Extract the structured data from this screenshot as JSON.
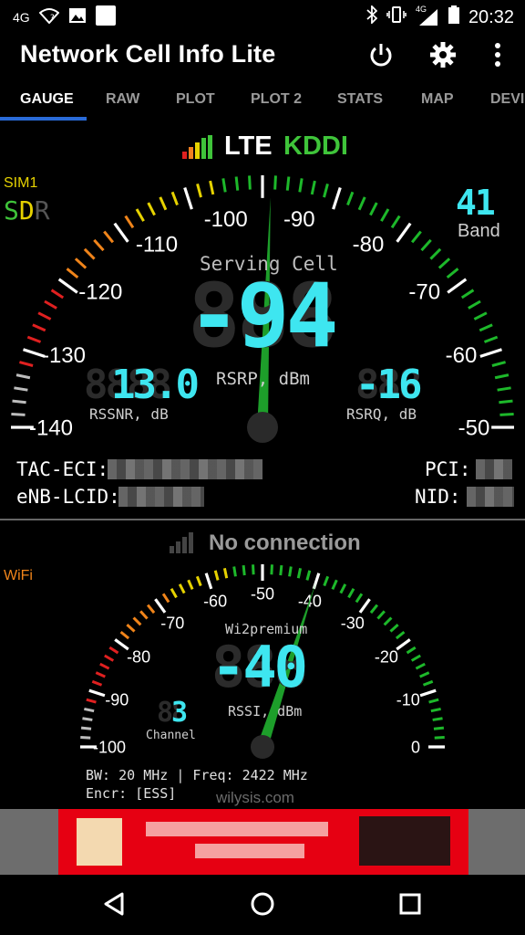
{
  "status": {
    "network_left": "4G",
    "network_right": "4G",
    "time": "20:32"
  },
  "app": {
    "title": "Network Cell Info Lite"
  },
  "tabs": [
    {
      "label": "GAUGE"
    },
    {
      "label": "RAW"
    },
    {
      "label": "PLOT"
    },
    {
      "label": "PLOT 2"
    },
    {
      "label": "STATS"
    },
    {
      "label": "MAP"
    },
    {
      "label": "DEVI"
    }
  ],
  "cell": {
    "tech": "LTE",
    "operator": "KDDI",
    "sim_label": "SIM1",
    "sdr_s": "S",
    "sdr_d": "D",
    "sdr_r": "R",
    "band_value": "41",
    "band_label": "Band",
    "serving_label": "Serving Cell",
    "rsrp_value": "-94",
    "rsrp_unit": "RSRP, dBm",
    "rssnr_value": "13.0",
    "rssnr_label": "RSSNR, dB",
    "rsrq_value": "-16",
    "rsrq_label": "RSRQ, dB",
    "scale": [
      "-140",
      "-130",
      "-120",
      "-110",
      "-100",
      "-90",
      "-80",
      "-70",
      "-60",
      "-50"
    ],
    "tac_eci_label": "TAC-ECI:",
    "enb_lcid_label": "eNB-LCID:",
    "pci_label": "PCI:",
    "nid_label": "NID:"
  },
  "wifi": {
    "status": "No connection",
    "label": "WiFi",
    "ssid": "Wi2premium",
    "rssi_value": "-40",
    "rssi_label": "RSSI, dBm",
    "channel_value": "3",
    "channel_label": "Channel",
    "scale": [
      "-100",
      "-90",
      "-80",
      "-70",
      "-60",
      "-50",
      "-40",
      "-30",
      "-20",
      "-10",
      "0"
    ],
    "bw_freq": "BW: 20 MHz | Freq: 2422 MHz",
    "encryption": "Encr: [ESS]"
  },
  "footer": {
    "brand": "wilysis.com"
  },
  "colors": {
    "accent_blue": "#2a6bd8",
    "digit_cyan": "#3ee6f0",
    "needle_green": "#1d9e2a",
    "operator_green": "#3fc43a",
    "sim_yellow": "#e6d200",
    "wifi_orange": "#f0841a"
  }
}
